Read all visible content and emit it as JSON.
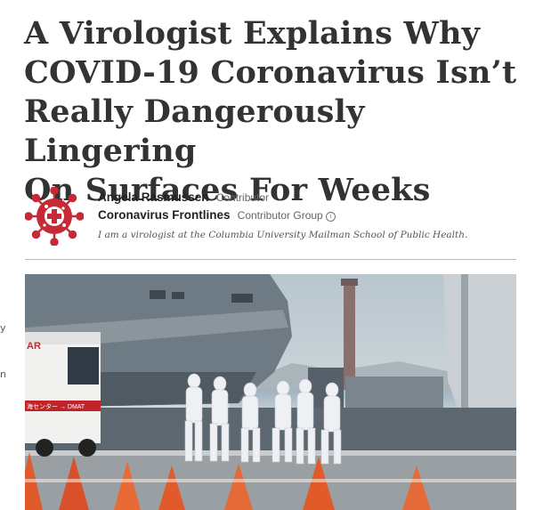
{
  "article": {
    "headline_lines": [
      "A Virologist Explains Why",
      "COVID-19 Coronavirus Isn’t",
      "Really Dangerously Lingering",
      "On Surfaces For Weeks"
    ]
  },
  "author": {
    "name": "Angela Rasmussen",
    "role": "Contributor",
    "group_name": "Coronavirus Frontlines",
    "group_role": "Contributor Group",
    "bio": "I am a virologist at the Columbia University Mailman School of Public Health.",
    "avatar_icon": "virus-plus-icon"
  },
  "photo": {
    "vehicle_text_1": "AR",
    "vehicle_text_2": "海センター → DMAT"
  },
  "colors": {
    "avatar": "#c62a36",
    "headline": "#333333"
  }
}
